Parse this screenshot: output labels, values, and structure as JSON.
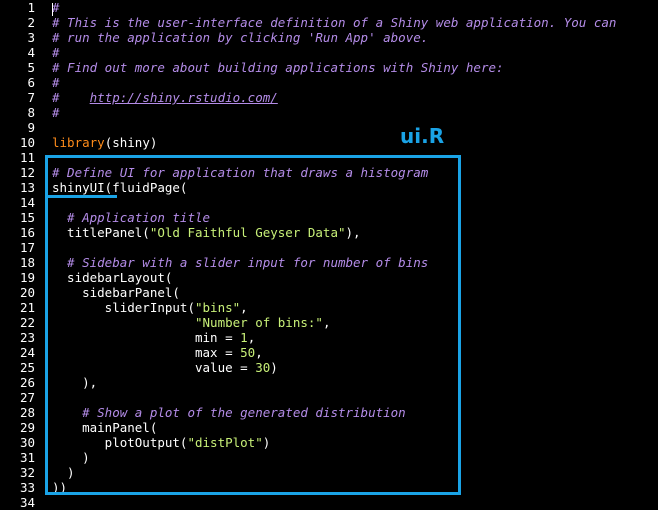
{
  "annotation": {
    "file_label": "ui.R"
  },
  "colors": {
    "accent": "#1aa3e6",
    "comment": "#b48ce8",
    "string": "#c8f078",
    "keyword": "#ff8c1a"
  },
  "lines": [
    {
      "n": "1",
      "segs": [
        {
          "t": "#",
          "c": "cmt"
        }
      ]
    },
    {
      "n": "2",
      "segs": [
        {
          "t": "# This is the user-interface definition of a Shiny web application. You can",
          "c": "cmt"
        }
      ]
    },
    {
      "n": "3",
      "segs": [
        {
          "t": "# run the application by clicking 'Run App' above.",
          "c": "cmt"
        }
      ]
    },
    {
      "n": "4",
      "segs": [
        {
          "t": "#",
          "c": "cmt"
        }
      ]
    },
    {
      "n": "5",
      "segs": [
        {
          "t": "# Find out more about building applications with Shiny here:",
          "c": "cmt"
        }
      ]
    },
    {
      "n": "6",
      "segs": [
        {
          "t": "#",
          "c": "cmt"
        }
      ]
    },
    {
      "n": "7",
      "segs": [
        {
          "t": "#    ",
          "c": "cmt"
        },
        {
          "t": "http://shiny.rstudio.com/",
          "c": "url"
        }
      ]
    },
    {
      "n": "8",
      "segs": [
        {
          "t": "#",
          "c": "cmt"
        }
      ]
    },
    {
      "n": "9",
      "segs": []
    },
    {
      "n": "10",
      "segs": [
        {
          "t": "library",
          "c": "kw"
        },
        {
          "t": "(shiny)",
          "c": ""
        }
      ]
    },
    {
      "n": "11",
      "segs": []
    },
    {
      "n": "12",
      "segs": [
        {
          "t": "# Define UI for application that draws a histogram",
          "c": "cmt"
        }
      ]
    },
    {
      "n": "13",
      "segs": [
        {
          "t": "shinyUI(fluidPage(",
          "c": ""
        }
      ]
    },
    {
      "n": "14",
      "segs": []
    },
    {
      "n": "15",
      "segs": [
        {
          "t": "  # Application title",
          "c": "cmt"
        }
      ]
    },
    {
      "n": "16",
      "segs": [
        {
          "t": "  titlePanel(",
          "c": ""
        },
        {
          "t": "\"Old Faithful Geyser Data\"",
          "c": "str"
        },
        {
          "t": "),",
          "c": ""
        }
      ]
    },
    {
      "n": "17",
      "segs": []
    },
    {
      "n": "18",
      "segs": [
        {
          "t": "  # Sidebar with a slider input for number of bins",
          "c": "cmt"
        }
      ]
    },
    {
      "n": "19",
      "segs": [
        {
          "t": "  sidebarLayout(",
          "c": ""
        }
      ]
    },
    {
      "n": "20",
      "segs": [
        {
          "t": "    sidebarPanel(",
          "c": ""
        }
      ]
    },
    {
      "n": "21",
      "segs": [
        {
          "t": "       sliderInput(",
          "c": ""
        },
        {
          "t": "\"bins\"",
          "c": "str"
        },
        {
          "t": ",",
          "c": ""
        }
      ]
    },
    {
      "n": "22",
      "segs": [
        {
          "t": "                   ",
          "c": ""
        },
        {
          "t": "\"Number of bins:\"",
          "c": "str"
        },
        {
          "t": ",",
          "c": ""
        }
      ]
    },
    {
      "n": "23",
      "segs": [
        {
          "t": "                   min = ",
          "c": ""
        },
        {
          "t": "1",
          "c": "num"
        },
        {
          "t": ",",
          "c": ""
        }
      ]
    },
    {
      "n": "24",
      "segs": [
        {
          "t": "                   max = ",
          "c": ""
        },
        {
          "t": "50",
          "c": "num"
        },
        {
          "t": ",",
          "c": ""
        }
      ]
    },
    {
      "n": "25",
      "segs": [
        {
          "t": "                   value = ",
          "c": ""
        },
        {
          "t": "30",
          "c": "num"
        },
        {
          "t": ")",
          "c": ""
        }
      ]
    },
    {
      "n": "26",
      "segs": [
        {
          "t": "    ),",
          "c": ""
        }
      ]
    },
    {
      "n": "27",
      "segs": []
    },
    {
      "n": "28",
      "segs": [
        {
          "t": "    # Show a plot of the generated distribution",
          "c": "cmt"
        }
      ]
    },
    {
      "n": "29",
      "segs": [
        {
          "t": "    mainPanel(",
          "c": ""
        }
      ]
    },
    {
      "n": "30",
      "segs": [
        {
          "t": "       plotOutput(",
          "c": ""
        },
        {
          "t": "\"distPlot\"",
          "c": "str"
        },
        {
          "t": ")",
          "c": ""
        }
      ]
    },
    {
      "n": "31",
      "segs": [
        {
          "t": "    )",
          "c": ""
        }
      ]
    },
    {
      "n": "32",
      "segs": [
        {
          "t": "  )",
          "c": ""
        }
      ]
    },
    {
      "n": "33",
      "segs": [
        {
          "t": "))",
          "c": ""
        }
      ]
    },
    {
      "n": "34",
      "segs": []
    }
  ]
}
